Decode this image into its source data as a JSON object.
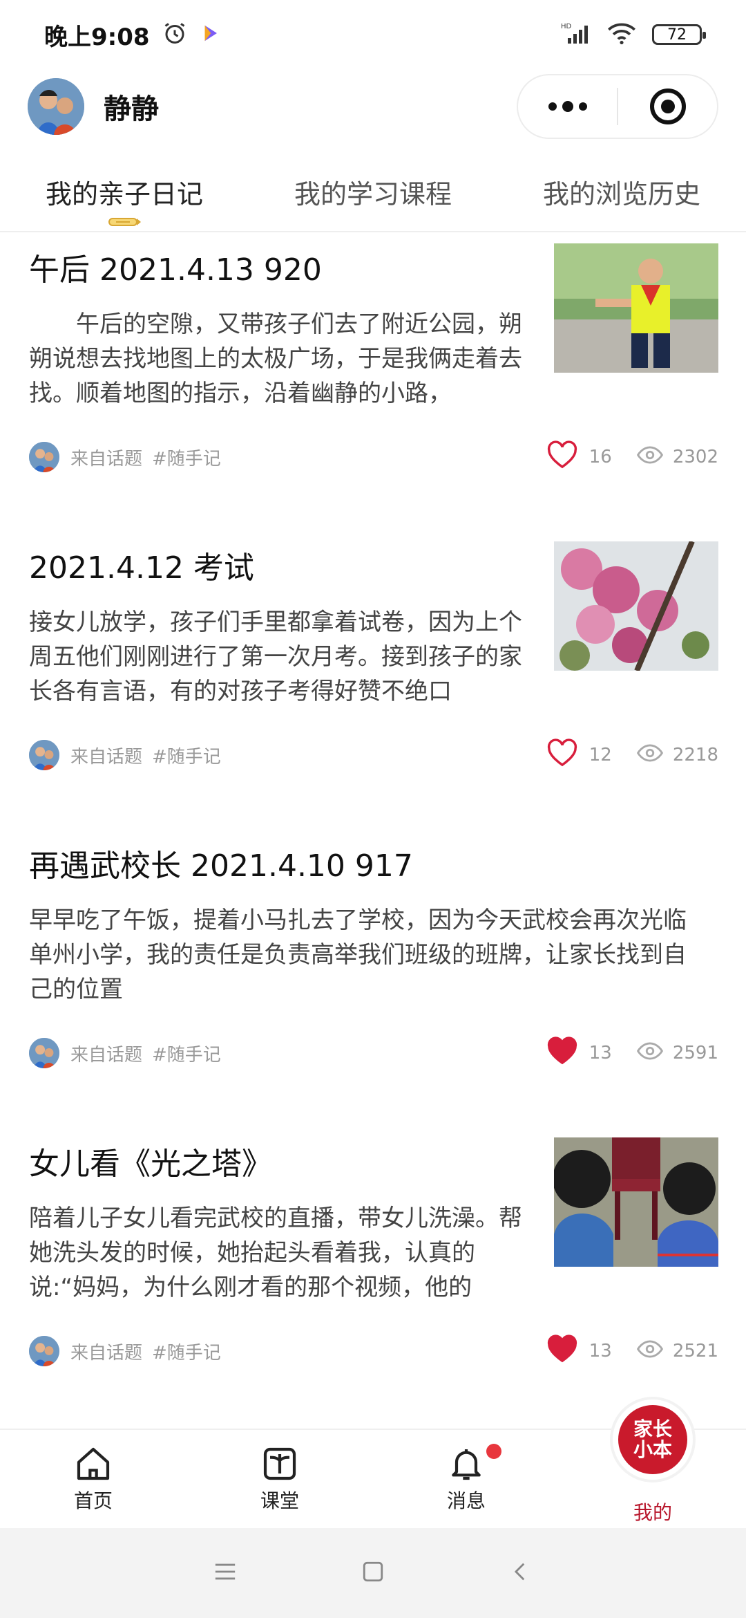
{
  "status_bar": {
    "time": "晚上9:08",
    "battery": "72",
    "network": "HD"
  },
  "header": {
    "username": "静静"
  },
  "tabs": [
    {
      "label": "我的亲子日记"
    },
    {
      "label": "我的学习课程"
    },
    {
      "label": "我的浏览历史"
    }
  ],
  "posts": [
    {
      "title": "午后 2021.4.13 920",
      "excerpt": "　　午后的空隙，又带孩子们去了附近公园，朔朔说想去找地图上的太极广场，于是我俩走着去找。顺着地图的指示，沿着幽静的小路，",
      "source": "来自话题",
      "tag": "#随手记",
      "likes": "16",
      "views": "2302",
      "liked": false
    },
    {
      "title": "2021.4.12 考试",
      "excerpt": "接女儿放学，孩子们手里都拿着试卷，因为上个周五他们刚刚进行了第一次月考。接到孩子的家长各有言语，有的对孩子考得好赞不绝口",
      "source": "来自话题",
      "tag": "#随手记",
      "likes": "12",
      "views": "2218",
      "liked": false
    },
    {
      "title": "再遇武校长 2021.4.10 917",
      "excerpt": "早早吃了午饭，提着小马扎去了学校，因为今天武校会再次光临单州小学，我的责任是负责高举我们班级的班牌，让家长找到自己的位置",
      "source": "来自话题",
      "tag": "#随手记",
      "likes": "13",
      "views": "2591",
      "liked": true
    },
    {
      "title": "女儿看《光之塔》",
      "excerpt": "陪着儿子女儿看完武校的直播，带女儿洗澡。帮她洗头发的时候，她抬起头看着我，认真的说:“妈妈，为什么刚才看的那个视频，他的",
      "source": "来自话题",
      "tag": "#随手记",
      "likes": "13",
      "views": "2521",
      "liked": true
    }
  ],
  "bottom_nav": [
    {
      "label": "首页",
      "icon": "home-icon"
    },
    {
      "label": "课堂",
      "icon": "book-icon"
    },
    {
      "label": "消息",
      "icon": "bell-icon"
    },
    {
      "label": "我的",
      "icon": "brand-logo"
    }
  ],
  "brand": {
    "line1": "家长",
    "line2": "小本"
  },
  "colors": {
    "accent": "#b8162b",
    "like_red": "#d81e3c",
    "badge": "#e8363d"
  }
}
